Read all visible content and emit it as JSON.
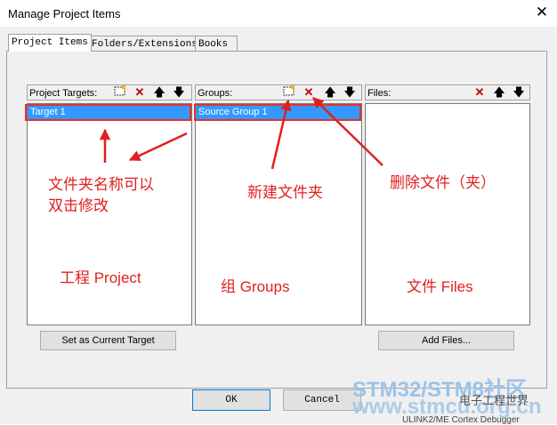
{
  "window": {
    "title": "Manage Project Items",
    "close_glyph": "✕"
  },
  "tabs": [
    {
      "label": "Project Items",
      "active": true
    },
    {
      "label": "Folders/Extensions",
      "active": false
    },
    {
      "label": "Books",
      "active": false
    }
  ],
  "columns": {
    "targets": {
      "header": "Project Targets:",
      "items": [
        "Target 1"
      ],
      "selected": "Target 1"
    },
    "groups": {
      "header": "Groups:",
      "items": [
        "Source Group 1"
      ],
      "selected": "Source Group 1"
    },
    "files": {
      "header": "Files:",
      "items": []
    }
  },
  "toolbar_icons": {
    "new": "new-folder-icon",
    "delete": "delete-icon",
    "up": "move-up-icon",
    "down": "move-down-icon"
  },
  "buttons": {
    "set_current_target": "Set as Current Target",
    "add_files": "Add Files...",
    "ok": "OK",
    "cancel": "Cancel"
  },
  "annotations": {
    "rename_hint_line1": "文件夹名称可以",
    "rename_hint_line2": "双击修改",
    "new_folder": "新建文件夹",
    "delete_file": "删除文件（夹）",
    "project_label": "工程 Project",
    "groups_label": "组 Groups",
    "files_label": "文件 Files"
  },
  "watermark": {
    "line1": "STM32/STM8社区",
    "line2": "www.stmcu.org.cn",
    "brand": "电子工程世界"
  },
  "background_text": "ULINK2/ME Cortex Debugger",
  "colors": {
    "selection": "#3399ff",
    "annotation": "#e02020",
    "highlight_box": "#e53030"
  }
}
